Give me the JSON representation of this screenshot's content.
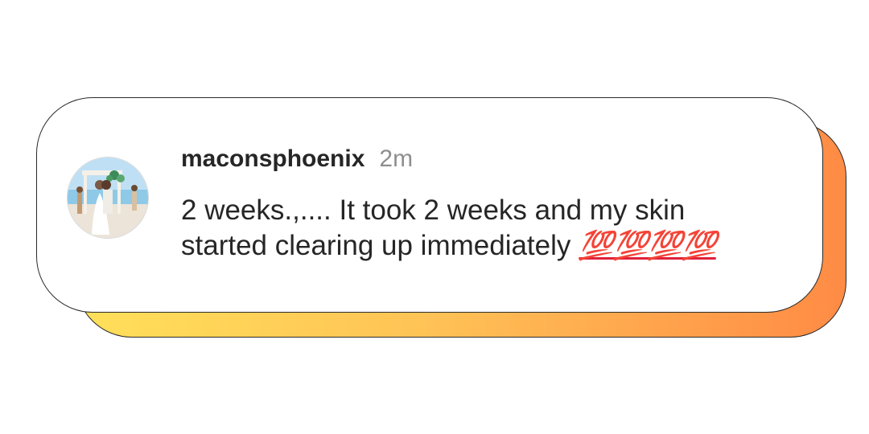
{
  "comment": {
    "username": "maconsphoenix",
    "timestamp": "2m",
    "text_line1": "2 weeks.,.... It took 2 weeks and my skin",
    "text_line2": "started clearing up immediately",
    "emoji": "💯💯💯💯"
  },
  "colors": {
    "card_border": "#2b2b2b",
    "gradient_start": "#ffe05a",
    "gradient_end": "#ff8b45",
    "username": "#262626",
    "timestamp": "#8e8e8e",
    "hundred_emoji": "#e0203a"
  },
  "icons": {
    "avatar": "wedding-photo-avatar",
    "emoji": "hundred-points-emoji"
  }
}
